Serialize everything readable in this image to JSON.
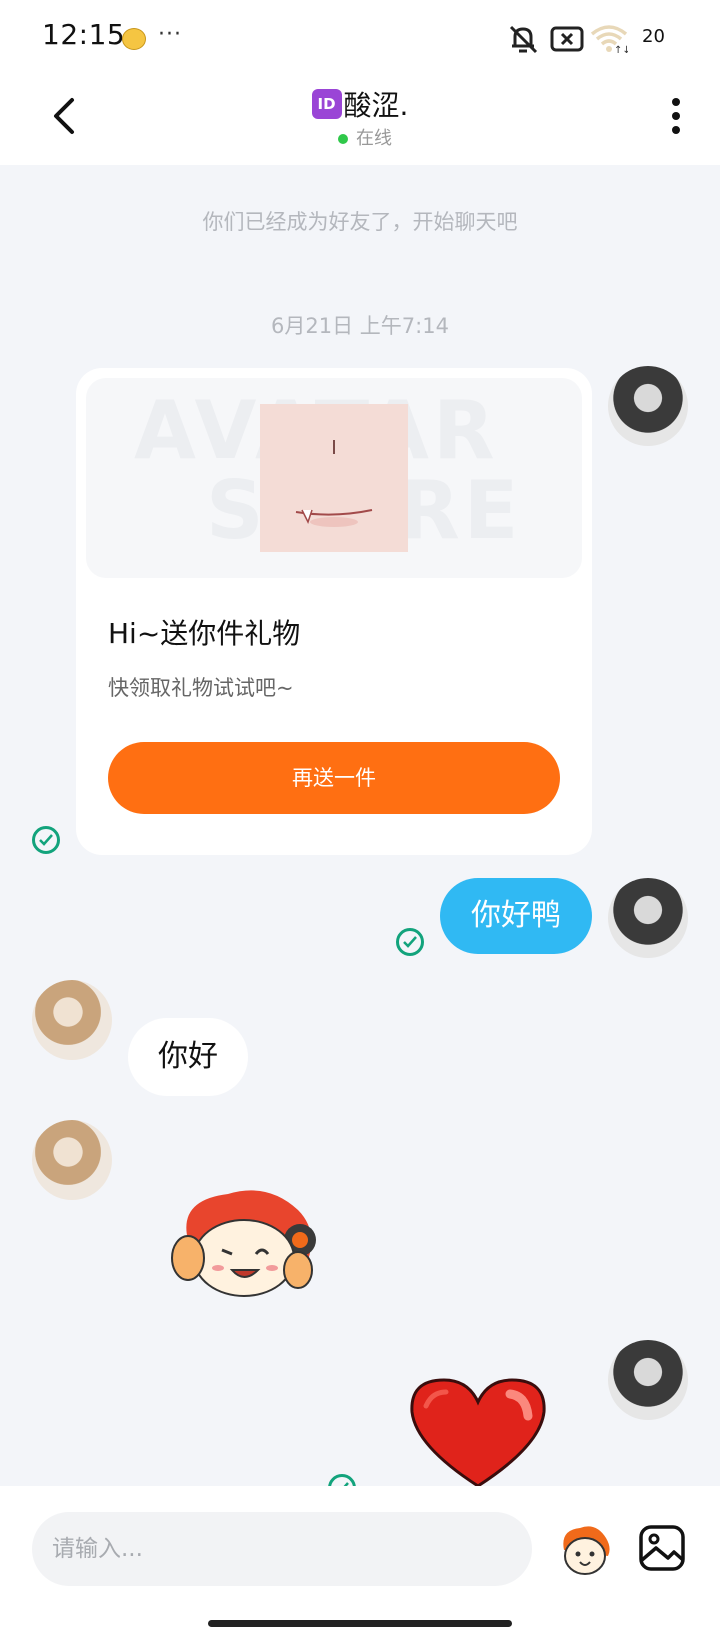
{
  "status_bar": {
    "time": "12:15",
    "dots": "···",
    "battery": "20"
  },
  "header": {
    "id_badge": "ID",
    "title": "酸涩.",
    "online_status": "在线"
  },
  "messages": {
    "system_friend": "你们已经成为好友了，开始聊天吧",
    "timestamp": "6月21日 上午7:14",
    "gift": {
      "watermark_top": "AVATAR",
      "watermark_bottom": "STORE",
      "title": "Hi~送你件礼物",
      "subtitle": "快领取礼物试试吧~",
      "button": "再送一件"
    },
    "my_text": "你好鸭",
    "peer_text": "你好"
  },
  "composer": {
    "placeholder": "请输入..."
  },
  "colors": {
    "accent_orange": "#ff6f12",
    "bubble_blue": "#30b9f3",
    "check_green": "#12a37c",
    "online_green": "#2fc84a",
    "id_purple": "#9a45d6"
  },
  "icons": [
    "back-arrow-icon",
    "more-vertical-icon",
    "muted-bell-icon",
    "screen-off-icon",
    "wifi-icon",
    "sent-check-icon",
    "emoji-sticker-icon",
    "image-picker-icon"
  ]
}
